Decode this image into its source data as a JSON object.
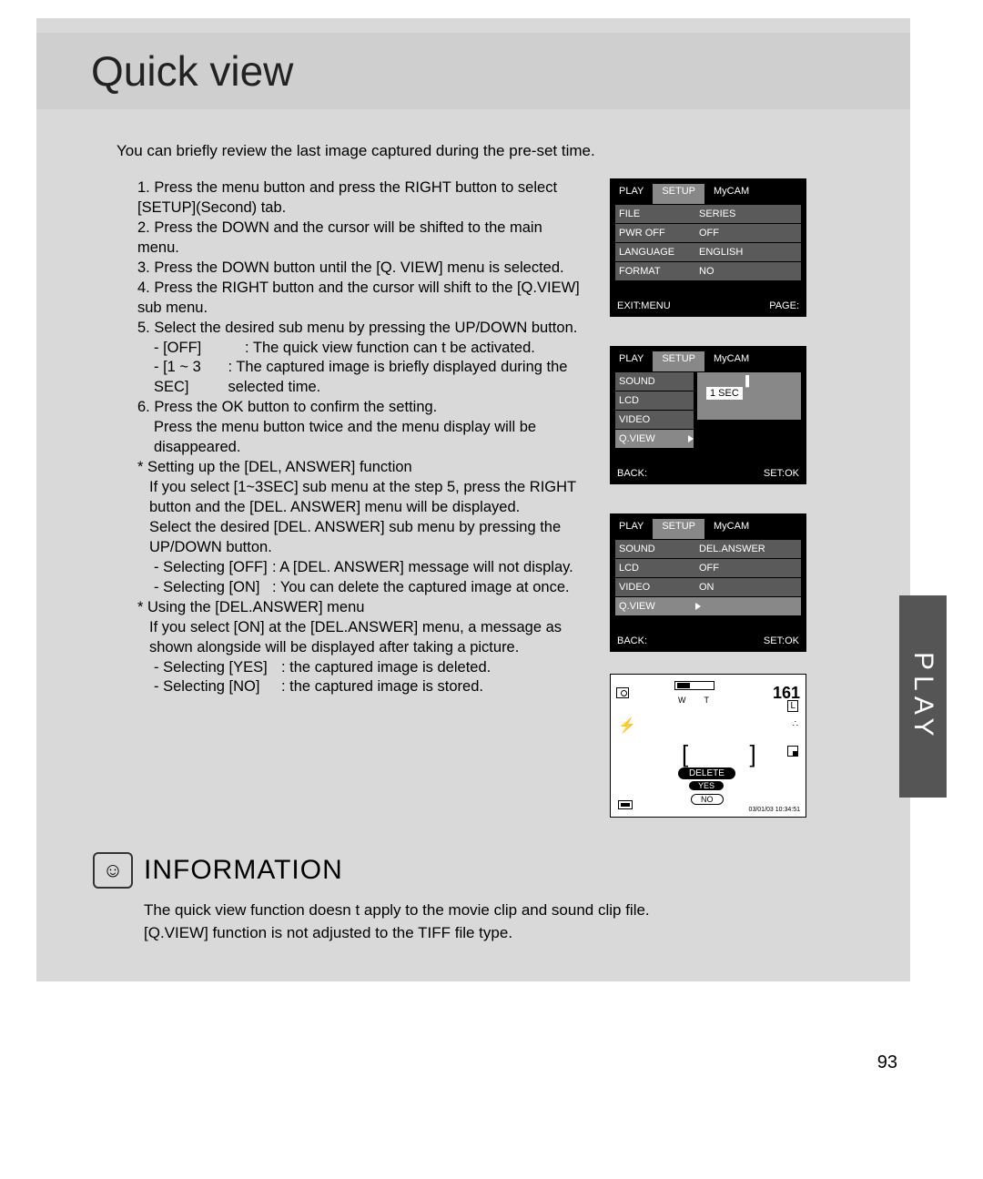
{
  "header": {
    "title": "Quick view"
  },
  "intro": "You can briefly review the last image captured during the pre-set time.",
  "steps": {
    "s1": "1. Press the menu button and press the RIGHT button to select [SETUP](Second) tab.",
    "s2": "2. Press the DOWN and the cursor will be shifted to the main menu.",
    "s3": "3. Press the DOWN button until the [Q. VIEW] menu is selected.",
    "s4": "4. Press the RIGHT button and the cursor will shift to the [Q.VIEW] sub menu.",
    "s5": "5. Select the desired sub menu by pressing the UP/DOWN button.",
    "s5a_l": "- [OFF]",
    "s5a_r": ": The quick view function can t be activated.",
    "s5b_l": "- [1 ~ 3 SEC]",
    "s5b_r": ": The captured image is briefly displayed during the selected time.",
    "s6": "6. Press the OK button to confirm the setting.",
    "s6b": "Press the menu button twice and the menu display will be disappeared.",
    "n1": "* Setting up the [DEL, ANSWER] function",
    "n1a": "If you select [1~3SEC] sub menu at the step 5, press the RIGHT button and the [DEL. ANSWER] menu will be displayed.",
    "n1b": "Select the desired [DEL. ANSWER] sub menu by pressing the UP/DOWN button.",
    "n1c_l": "- Selecting [OFF]",
    "n1c_r": ": A [DEL. ANSWER] message will not display.",
    "n1d_l": "- Selecting [ON]",
    "n1d_r": ": You can delete the captured image at once.",
    "n2": "* Using the [DEL.ANSWER] menu",
    "n2a": "If you select [ON] at the [DEL.ANSWER] menu, a message as shown alongside will be displayed after taking a picture.",
    "n2b_l": "- Selecting [YES]",
    "n2b_r": ": the captured image is deleted.",
    "n2c_l": "- Selecting [NO]",
    "n2c_r": ": the captured image is stored."
  },
  "side_tab": "PLAY",
  "information": {
    "heading": "INFORMATION",
    "b1": "The quick view function doesn t apply to the movie clip and sound clip file.",
    "b2": "[Q.VIEW] function is not adjusted to the TIFF file type."
  },
  "page_number": "93",
  "lcd_tabs": {
    "play": "PLAY",
    "setup": "SETUP",
    "mycam": "MyCAM"
  },
  "lcd1": {
    "file": "FILE",
    "file_v": "SERIES",
    "pwr": "PWR OFF",
    "pwr_v": "OFF",
    "lang": "LANGUAGE",
    "lang_v": "ENGLISH",
    "fmt": "FORMAT",
    "fmt_v": "NO",
    "foot_l": "EXIT:MENU",
    "foot_r": "PAGE:"
  },
  "lcd2": {
    "sound": "SOUND",
    "lcd": "LCD",
    "video": "VIDEO",
    "qview": "Q.VIEW",
    "val": "1 SEC",
    "foot_l": "BACK:",
    "foot_r": "SET:OK"
  },
  "lcd3": {
    "sound": "SOUND",
    "lcd": "LCD",
    "video": "VIDEO",
    "qview": "Q.VIEW",
    "del": "DEL.ANSWER",
    "off": "OFF",
    "on": "ON",
    "foot_l": "BACK:",
    "foot_r": "SET:OK"
  },
  "preview": {
    "count": "161",
    "w": "W",
    "t": "T",
    "l": "L",
    "delete": "DELETE",
    "yes": "YES",
    "no": "NO",
    "stamp": "03/01/03  10:34:51"
  }
}
